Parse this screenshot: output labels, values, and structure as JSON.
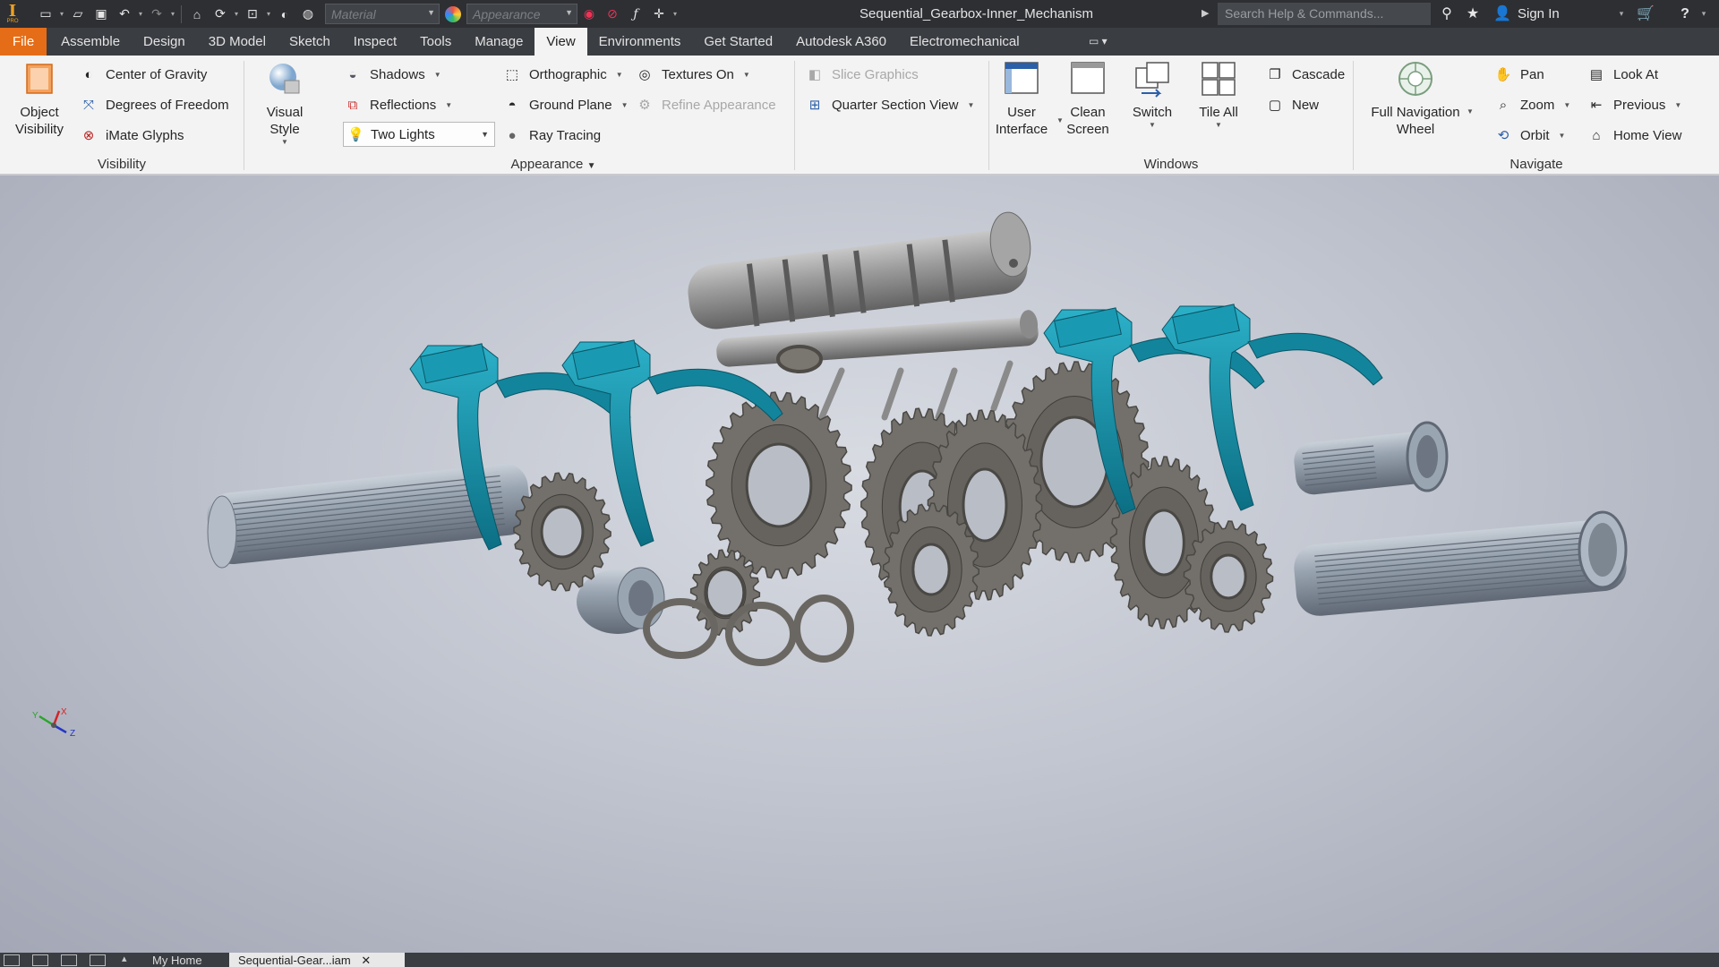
{
  "app": {
    "title": "Sequential_Gearbox-Inner_Mechanism",
    "logo_letter": "I",
    "logo_sub": "PRO",
    "material_placeholder": "Material",
    "appearance_placeholder": "Appearance",
    "search_placeholder": "Search Help & Commands...",
    "sign_in": "Sign In",
    "accent_color": "#e56d18"
  },
  "tabs": [
    {
      "label": "File"
    },
    {
      "label": "Assemble"
    },
    {
      "label": "Design"
    },
    {
      "label": "3D Model"
    },
    {
      "label": "Sketch"
    },
    {
      "label": "Inspect"
    },
    {
      "label": "Tools"
    },
    {
      "label": "Manage"
    },
    {
      "label": "View"
    },
    {
      "label": "Environments"
    },
    {
      "label": "Get Started"
    },
    {
      "label": "Autodesk A360"
    },
    {
      "label": "Electromechanical"
    }
  ],
  "ribbon": {
    "visibility": {
      "label": "Visibility",
      "object_visibility": "Object Visibility",
      "center_of_gravity": "Center of Gravity",
      "degrees_of_freedom": "Degrees of Freedom",
      "imate_glyphs": "iMate Glyphs"
    },
    "appearance": {
      "label": "Appearance",
      "visual_style": "Visual Style",
      "shadows": "Shadows",
      "reflections": "Reflections",
      "lighting": "Two Lights",
      "orthographic": "Orthographic",
      "ground_plane": "Ground Plane",
      "ray_tracing": "Ray Tracing",
      "textures_on": "Textures On",
      "refine_appearance": "Refine Appearance",
      "slice_graphics": "Slice Graphics",
      "quarter_section_view": "Quarter Section View"
    },
    "windows": {
      "label": "Windows",
      "user_interface": "User Interface",
      "clean_screen": "Clean Screen",
      "switch": "Switch",
      "tile_all": "Tile All",
      "cascade": "Cascade",
      "new": "New"
    },
    "navigate": {
      "label": "Navigate",
      "full_navigation_wheel": "Full Navigation Wheel",
      "pan": "Pan",
      "zoom": "Zoom",
      "orbit": "Orbit",
      "look_at": "Look At",
      "previous": "Previous",
      "home_view": "Home View"
    }
  },
  "viewport": {
    "triad_labels": [
      "Y",
      "X",
      "Z"
    ],
    "colors": {
      "fork": "#12859c",
      "gear": "#73706b",
      "shaft": "#8e9aa8"
    }
  },
  "bottom_tabs": {
    "home": "My Home",
    "document": "Sequential-Gear...iam"
  }
}
